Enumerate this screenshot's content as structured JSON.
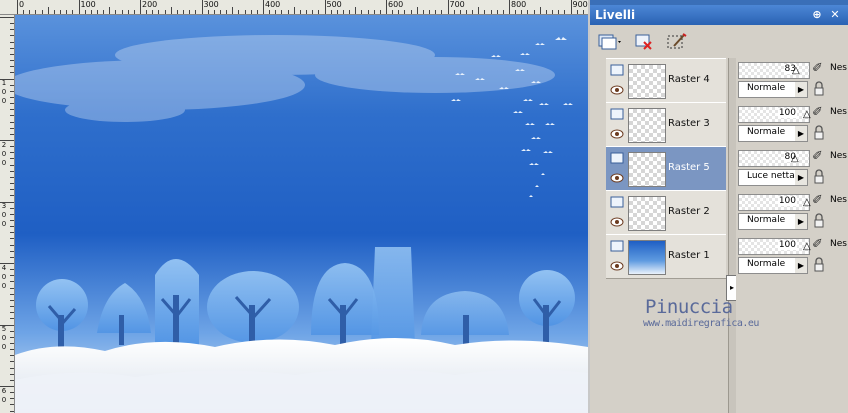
{
  "ruler": {
    "top_labels": [
      "0",
      "100",
      "200",
      "300",
      "400",
      "500",
      "600",
      "700",
      "800",
      "900"
    ],
    "left_labels": [
      "1",
      "0",
      "0",
      "2",
      "0",
      "0",
      "3",
      "0",
      "0",
      "4",
      "0",
      "0",
      "5",
      "0",
      "0",
      "6",
      "0"
    ]
  },
  "palette": {
    "title": "Livelli",
    "pin_glyph": "⊕",
    "close_glyph": "✕",
    "tools": [
      "new-layer-icon",
      "delete-layer-icon",
      "edit-selection-icon"
    ]
  },
  "layers": [
    {
      "name": "Raster 4",
      "opacity": "83",
      "blend": "Normale",
      "partial_name": "Nes",
      "selected": false,
      "thumb": "transparent"
    },
    {
      "name": "Raster 3",
      "opacity": "100",
      "blend": "Normale",
      "partial_name": "Nes",
      "selected": false,
      "thumb": "transparent"
    },
    {
      "name": "Raster 5",
      "opacity": "80",
      "blend": "Luce netta",
      "partial_name": "Nes",
      "selected": true,
      "thumb": "transparent"
    },
    {
      "name": "Raster 2",
      "opacity": "100",
      "blend": "Normale",
      "partial_name": "Nes",
      "selected": false,
      "thumb": "transparent"
    },
    {
      "name": "Raster 1",
      "opacity": "100",
      "blend": "Normale",
      "partial_name": "Nes",
      "selected": false,
      "thumb": "image"
    }
  ],
  "watermark": {
    "title": "Pinuccia",
    "url": "www.maidiregrafica.eu"
  },
  "colors": {
    "accent": "#2a62b3",
    "selected_row": "#7b96c2",
    "sky_top": "#1f5fc4",
    "sky_bottom": "#9cc3ee",
    "snow": "#f4f6fa"
  }
}
